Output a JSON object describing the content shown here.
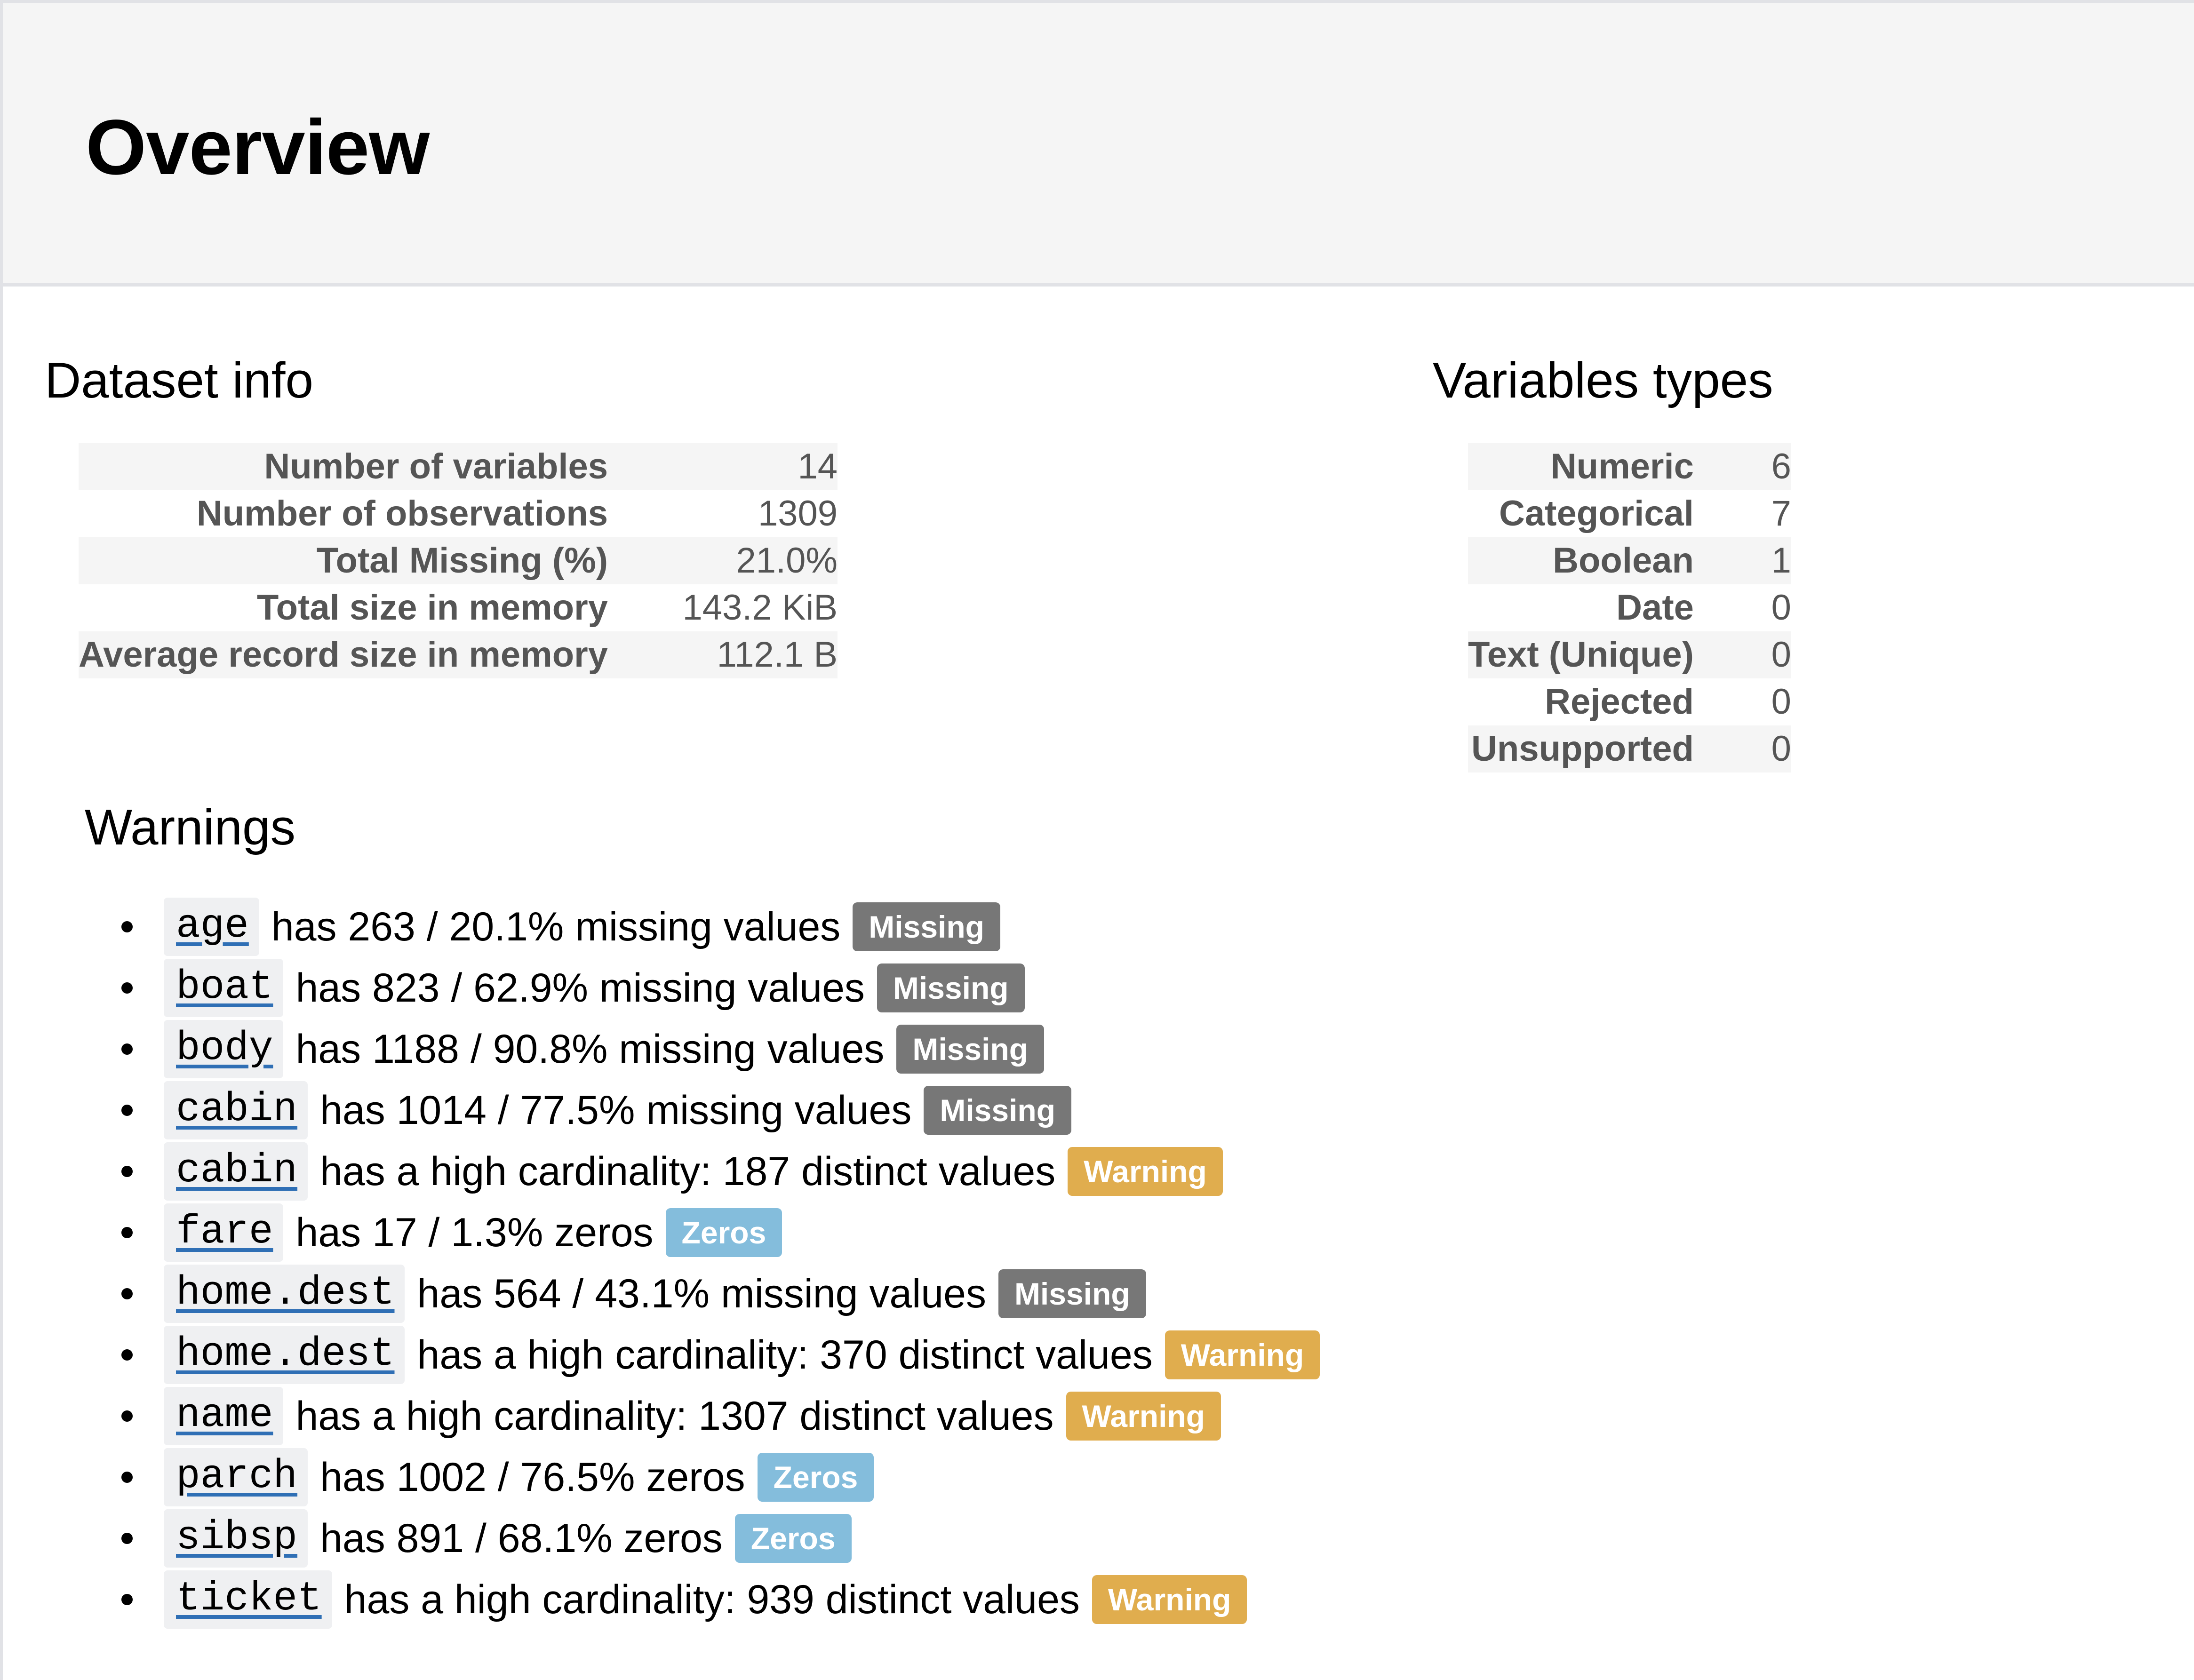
{
  "header": {
    "title": "Overview"
  },
  "dataset_info": {
    "title": "Dataset info",
    "rows": [
      {
        "label": "Number of variables",
        "value": "14"
      },
      {
        "label": "Number of observations",
        "value": "1309"
      },
      {
        "label": "Total Missing (%)",
        "value": "21.0%"
      },
      {
        "label": "Total size in memory",
        "value": "143.2 KiB"
      },
      {
        "label": "Average record size in memory",
        "value": "112.1 B"
      }
    ]
  },
  "variable_types": {
    "title": "Variables types",
    "rows": [
      {
        "label": "Numeric",
        "value": "6"
      },
      {
        "label": "Categorical",
        "value": "7"
      },
      {
        "label": "Boolean",
        "value": "1"
      },
      {
        "label": "Date",
        "value": "0"
      },
      {
        "label": "Text (Unique)",
        "value": "0"
      },
      {
        "label": "Rejected",
        "value": "0"
      },
      {
        "label": "Unsupported",
        "value": "0"
      }
    ]
  },
  "warnings": {
    "title": "Warnings",
    "badge_colors": {
      "Missing": "#777777",
      "Warning": "#e0ad4e",
      "Zeros": "#84bddc"
    },
    "items": [
      {
        "variable": "age",
        "message": "has 263 / 20.1% missing values",
        "badge": "Missing"
      },
      {
        "variable": "boat",
        "message": "has 823 / 62.9% missing values",
        "badge": "Missing"
      },
      {
        "variable": "body",
        "message": "has 1188 / 90.8% missing values",
        "badge": "Missing"
      },
      {
        "variable": "cabin",
        "message": "has 1014 / 77.5% missing values",
        "badge": "Missing"
      },
      {
        "variable": "cabin",
        "message": "has a high cardinality: 187 distinct values",
        "badge": "Warning"
      },
      {
        "variable": "fare",
        "message": "has 17 / 1.3% zeros",
        "badge": "Zeros"
      },
      {
        "variable": "home.dest",
        "message": "has 564 / 43.1% missing values",
        "badge": "Missing"
      },
      {
        "variable": "home.dest",
        "message": "has a high cardinality: 370 distinct values",
        "badge": "Warning"
      },
      {
        "variable": "name",
        "message": "has a high cardinality: 1307 distinct values",
        "badge": "Warning"
      },
      {
        "variable": "parch",
        "message": "has 1002 / 76.5% zeros",
        "badge": "Zeros"
      },
      {
        "variable": "sibsp",
        "message": "has 891 / 68.1% zeros",
        "badge": "Zeros"
      },
      {
        "variable": "ticket",
        "message": "has a high cardinality: 939 distinct values",
        "badge": "Warning"
      }
    ]
  }
}
